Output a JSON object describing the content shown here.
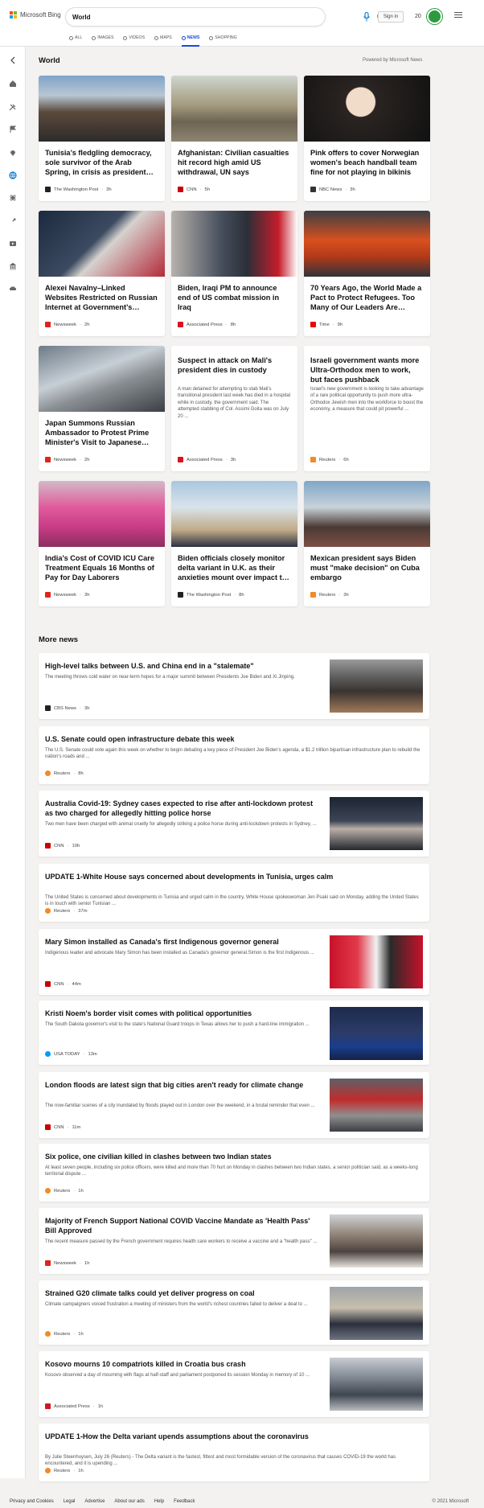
{
  "header": {
    "brand": "Microsoft Bing",
    "search_value": "World",
    "signin_label": "Sign in",
    "rewards_count": "20",
    "scopes": [
      {
        "label": "ALL",
        "active": false
      },
      {
        "label": "IMAGES",
        "active": false
      },
      {
        "label": "VIDEOS",
        "active": false
      },
      {
        "label": "MAPS",
        "active": false
      },
      {
        "label": "NEWS",
        "active": true
      },
      {
        "label": "SHOPPING",
        "active": false
      }
    ]
  },
  "sidebar_icons": [
    "back-arrow-icon",
    "home-icon",
    "tools-icon",
    "flag-icon",
    "location-pin-icon",
    "globe-icon",
    "science-icon",
    "rocket-icon",
    "entertainment-icon",
    "bank-icon",
    "car-icon"
  ],
  "section": {
    "title": "World",
    "powered_by": "Powered by Microsoft News"
  },
  "cards": [
    {
      "headline": "Tunisia’s fledgling democracy, sole survivor of the Arab Spring, in crisis as president…",
      "snippet": "",
      "provider": "The Washington Post",
      "age": "3h",
      "logo_color": "#222222"
    },
    {
      "headline": "Afghanistan: Civilian casualties hit record high amid US withdrawal, UN says",
      "snippet": "",
      "provider": "CNN",
      "age": "5h",
      "logo_color": "#cc0000"
    },
    {
      "headline": "Pink offers to cover Norwegian women's beach handball team fine for not playing in bikinis",
      "snippet": "",
      "provider": "NBC News",
      "age": "3h",
      "logo_color": "#333333"
    },
    {
      "headline": "Alexei Navalny–Linked Websites Restricted on Russian Internet at Government's…",
      "snippet": "",
      "provider": "Newsweek",
      "age": "2h",
      "logo_color": "#e2231a"
    },
    {
      "headline": "Biden, Iraqi PM to announce end of US combat mission in Iraq",
      "snippet": "",
      "provider": "Associated Press",
      "age": "8h",
      "logo_color": "#d4151f"
    },
    {
      "headline": "70 Years Ago, the World Made a Pact to Protect Refugees. Too Many of Our Leaders Are…",
      "snippet": "",
      "provider": "Time",
      "age": "9h",
      "logo_color": "#e90606"
    },
    {
      "headline": "Japan Summons Russian Ambassador to Protest Prime Minister's Visit to Japanese…",
      "snippet": "",
      "provider": "Newsweek",
      "age": "2h",
      "logo_color": "#e2231a"
    },
    {
      "headline": "Suspect in attack on Mali's president dies in custody",
      "snippet": "A man detained for attempting to stab Mali's transitional president last week has died in a hospital while in custody, the government said. The attempted stabbing of Col. Assimi Goita was on July 20 ...",
      "provider": "Associated Press",
      "age": "3h",
      "logo_color": "#d4151f"
    },
    {
      "headline": "Israeli government wants more Ultra-Orthodox men to work, but faces pushback",
      "snippet": "Israel's new government is looking to take advantage of a rare political opportunity to push more ultra-Orthodox Jewish men into the workforce to boost the economy, a measure that could pit powerful ...",
      "provider": "Reuters",
      "age": "6h",
      "logo_color": "#f28a25"
    },
    {
      "headline": "India's Cost of COVID ICU Care Treatment Equals 16 Months of Pay for Day Laborers",
      "snippet": "",
      "provider": "Newsweek",
      "age": "3h",
      "logo_color": "#e2231a"
    },
    {
      "headline": "Biden officials closely monitor delta variant in U.K. as their anxieties mount over impact t…",
      "snippet": "",
      "provider": "The Washington Post",
      "age": "8h",
      "logo_color": "#222222"
    },
    {
      "headline": "Mexican president says Biden must \"make decision\" on Cuba embargo",
      "snippet": "",
      "provider": "Reuters",
      "age": "3h",
      "logo_color": "#f28a25"
    }
  ],
  "more_news": {
    "title": "More news",
    "items": [
      {
        "title": "High-level talks between U.S. and China end in a \"stalemate\"",
        "snippet": "The meeting throws cold water on near-term hopes for a major summit between Presidents Joe Biden and Xi Jinping.",
        "provider": "CBS News",
        "age": "3h",
        "logo_color": "#222222",
        "has_image": true
      },
      {
        "title": "U.S. Senate could open infrastructure debate this week",
        "snippet": "The U.S. Senate could vote again this week on whether to begin debating a key piece of President Joe Biden's agenda, a $1.2 trillion bipartisan infrastructure plan to rebuild the nation's roads and ...",
        "provider": "Reuters",
        "age": "8h",
        "logo_color": "#f28a25",
        "has_image": false
      },
      {
        "title": "Australia Covid-19: Sydney cases expected to rise after anti-lockdown protest as two charged for allegedly hitting police horse",
        "snippet": "Two men have been charged with animal cruelty for allegedly striking a police horse during anti-lockdown protests in Sydney, ...",
        "provider": "CNN",
        "age": "10h",
        "logo_color": "#cc0000",
        "has_image": true
      },
      {
        "title": "UPDATE 1-White House says concerned about developments in Tunisia, urges calm",
        "snippet": "The United States is concerned about developments in Tunisia and urged calm in the country, White House spokeswoman Jen Psaki said on Monday, adding the United States is in touch with senior Tunisian ...",
        "provider": "Reuters",
        "age": "37m",
        "logo_color": "#f28a25",
        "has_image": false
      },
      {
        "title": "Mary Simon installed as Canada's first Indigenous governor general",
        "snippet": "Indigenous leader and advocate Mary Simon has been installed as Canada's governor general.Simon is the first Indigenous ...",
        "provider": "CNN",
        "age": "44m",
        "logo_color": "#cc0000",
        "has_image": true
      },
      {
        "title": "Kristi Noem's border visit comes with political opportunities",
        "snippet": "The South Dakota governor's visit to the state's National Guard troops in Texas allows her to push a hard-line immigration ...",
        "provider": "USA TODAY",
        "age": "13m",
        "logo_color": "#009bff",
        "has_image": true
      },
      {
        "title": "London floods are latest sign that big cities aren't ready for climate change",
        "snippet": "The now-familiar scenes of a city inundated by floods played out in London over the weekend, in a brutal reminder that even ...",
        "provider": "CNN",
        "age": "11m",
        "logo_color": "#cc0000",
        "has_image": true
      },
      {
        "title": "Six police, one civilian killed in clashes between two Indian states",
        "snippet": "At least seven people, including six police officers, were killed and more than 70 hurt on Monday in clashes between two Indian states, a senior politician said, as a weeks-long territorial dispute ...",
        "provider": "Reuters",
        "age": "1h",
        "logo_color": "#f28a25",
        "has_image": false
      },
      {
        "title": "Majority of French Support National COVID Vaccine Mandate as 'Health Pass' Bill Approved",
        "snippet": "The recent measure passed by the French government requires health care workers to receive a vaccine and a \"health pass\" ...",
        "provider": "Newsweek",
        "age": "1h",
        "logo_color": "#e2231a",
        "has_image": true
      },
      {
        "title": "Strained G20 climate talks could yet deliver progress on coal",
        "snippet": "Climate campaigners voiced frustration a meeting of ministers from the world's richest countries failed to deliver a deal to ...",
        "provider": "Reuters",
        "age": "1h",
        "logo_color": "#f28a25",
        "has_image": true
      },
      {
        "title": "Kosovo mourns 10 compatriots killed in Croatia bus crash",
        "snippet": "Kosovo observed a day of mourning with flags at half-staff and parliament postponed its session Monday in memory of 10 ...",
        "provider": "Associated Press",
        "age": "1h",
        "logo_color": "#d4151f",
        "has_image": true
      },
      {
        "title": "UPDATE 1-How the Delta variant upends assumptions about the coronavirus",
        "snippet": "By Julie Steenhuysen, July 26 (Reuters) - The Delta variant is the fastest, fittest and most formidable version of the coronavirus that causes COVID-19 the world has encountered, and it is upending ...",
        "provider": "Reuters",
        "age": "1h",
        "logo_color": "#f28a25",
        "has_image": false
      }
    ]
  },
  "footer": {
    "links": [
      "Privacy and Cookies",
      "Legal",
      "Advertise",
      "About our ads",
      "Help",
      "Feedback"
    ],
    "copyright": "© 2021 Microsoft"
  },
  "colors": {
    "accent": "#174ae4",
    "bing_blue": "#0078d4",
    "rewards_green": "#2c9a3f"
  }
}
